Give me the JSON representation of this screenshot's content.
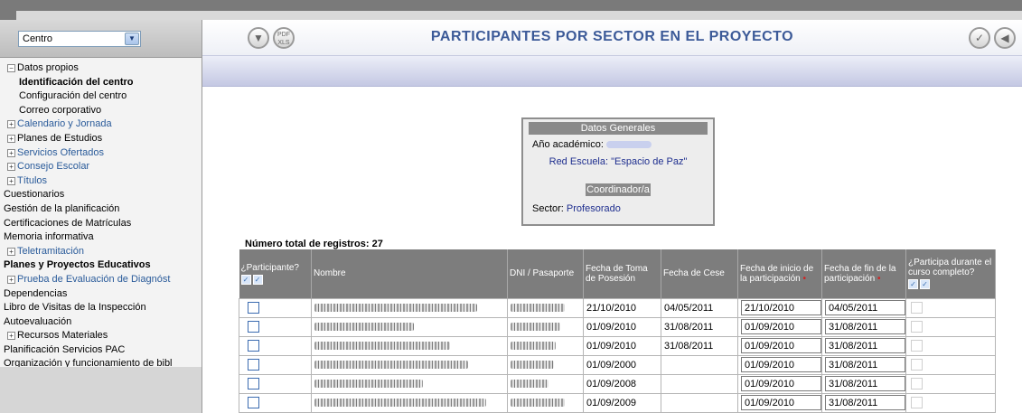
{
  "sidebar": {
    "selector_value": "Centro",
    "items": [
      {
        "label": "Datos propios",
        "toggle": "−",
        "level": 1,
        "style": ""
      },
      {
        "label": "Identificación del centro",
        "toggle": "",
        "level": 2,
        "style": "bold"
      },
      {
        "label": "Configuración del centro",
        "toggle": "",
        "level": 2,
        "style": ""
      },
      {
        "label": "Correo corporativo",
        "toggle": "",
        "level": 2,
        "style": ""
      },
      {
        "label": "Calendario y Jornada",
        "toggle": "+",
        "level": 1,
        "style": "blue"
      },
      {
        "label": "Planes de Estudios",
        "toggle": "+",
        "level": 1,
        "style": ""
      },
      {
        "label": "Servicios Ofertados",
        "toggle": "+",
        "level": 1,
        "style": "blue"
      },
      {
        "label": "Consejo Escolar",
        "toggle": "+",
        "level": 1,
        "style": "blue"
      },
      {
        "label": "Títulos",
        "toggle": "+",
        "level": 1,
        "style": "blue"
      },
      {
        "label": "Cuestionarios",
        "toggle": "",
        "level": 0,
        "style": ""
      },
      {
        "label": "Gestión de la planificación",
        "toggle": "",
        "level": 0,
        "style": ""
      },
      {
        "label": "Certificaciones de Matrículas",
        "toggle": "",
        "level": 0,
        "style": ""
      },
      {
        "label": "Memoria informativa",
        "toggle": "",
        "level": 0,
        "style": ""
      },
      {
        "label": "Teletramitación",
        "toggle": "+",
        "level": 1,
        "style": "blue"
      },
      {
        "label": "Planes y Proyectos Educativos",
        "toggle": "",
        "level": 0,
        "style": "bold"
      },
      {
        "label": "Prueba de Evaluación de Diagnóst",
        "toggle": "+",
        "level": 1,
        "style": "blue"
      },
      {
        "label": "Dependencias",
        "toggle": "",
        "level": 0,
        "style": ""
      },
      {
        "label": "Libro de Visitas de la Inspección",
        "toggle": "",
        "level": 0,
        "style": ""
      },
      {
        "label": "Autoevaluación",
        "toggle": "",
        "level": 0,
        "style": ""
      },
      {
        "label": "Recursos Materiales",
        "toggle": "+",
        "level": 1,
        "style": ""
      },
      {
        "label": "Planificación Servicios PAC",
        "toggle": "",
        "level": 0,
        "style": ""
      },
      {
        "label": "Organización y funcionamiento de bibl",
        "toggle": "",
        "level": 0,
        "style": ""
      }
    ]
  },
  "header": {
    "title": "PARTICIPANTES POR SECTOR EN EL PROYECTO",
    "pdf_icon_text": "PDF XLS"
  },
  "info_box": {
    "heading": "Datos Generales",
    "year_label": "Año académico:",
    "network": "Red Escuela: \"Espacio de Paz\"",
    "role_button": "Coordinador/a",
    "sector_label": "Sector:",
    "sector_value": "Profesorado"
  },
  "total_records": "Número total de registros: 27",
  "table": {
    "columns": [
      "¿Participante?",
      "Nombre",
      "DNI / Pasaporte",
      "Fecha de Toma de Posesión",
      "Fecha de Cese",
      "Fecha de inicio de la participación",
      "Fecha de fin de la participación",
      "¿Participa durante el curso completo?"
    ],
    "rows": [
      {
        "toma": "21/10/2010",
        "cese": "04/05/2011",
        "inicio": "21/10/2010",
        "fin": "04/05/2011"
      },
      {
        "toma": "01/09/2010",
        "cese": "31/08/2011",
        "inicio": "01/09/2010",
        "fin": "31/08/2011"
      },
      {
        "toma": "01/09/2010",
        "cese": "31/08/2011",
        "inicio": "01/09/2010",
        "fin": "31/08/2011"
      },
      {
        "toma": "01/09/2000",
        "cese": "",
        "inicio": "01/09/2010",
        "fin": "31/08/2011"
      },
      {
        "toma": "01/09/2008",
        "cese": "",
        "inicio": "01/09/2010",
        "fin": "31/08/2011"
      },
      {
        "toma": "01/09/2009",
        "cese": "",
        "inicio": "01/09/2010",
        "fin": "31/08/2011"
      }
    ]
  }
}
